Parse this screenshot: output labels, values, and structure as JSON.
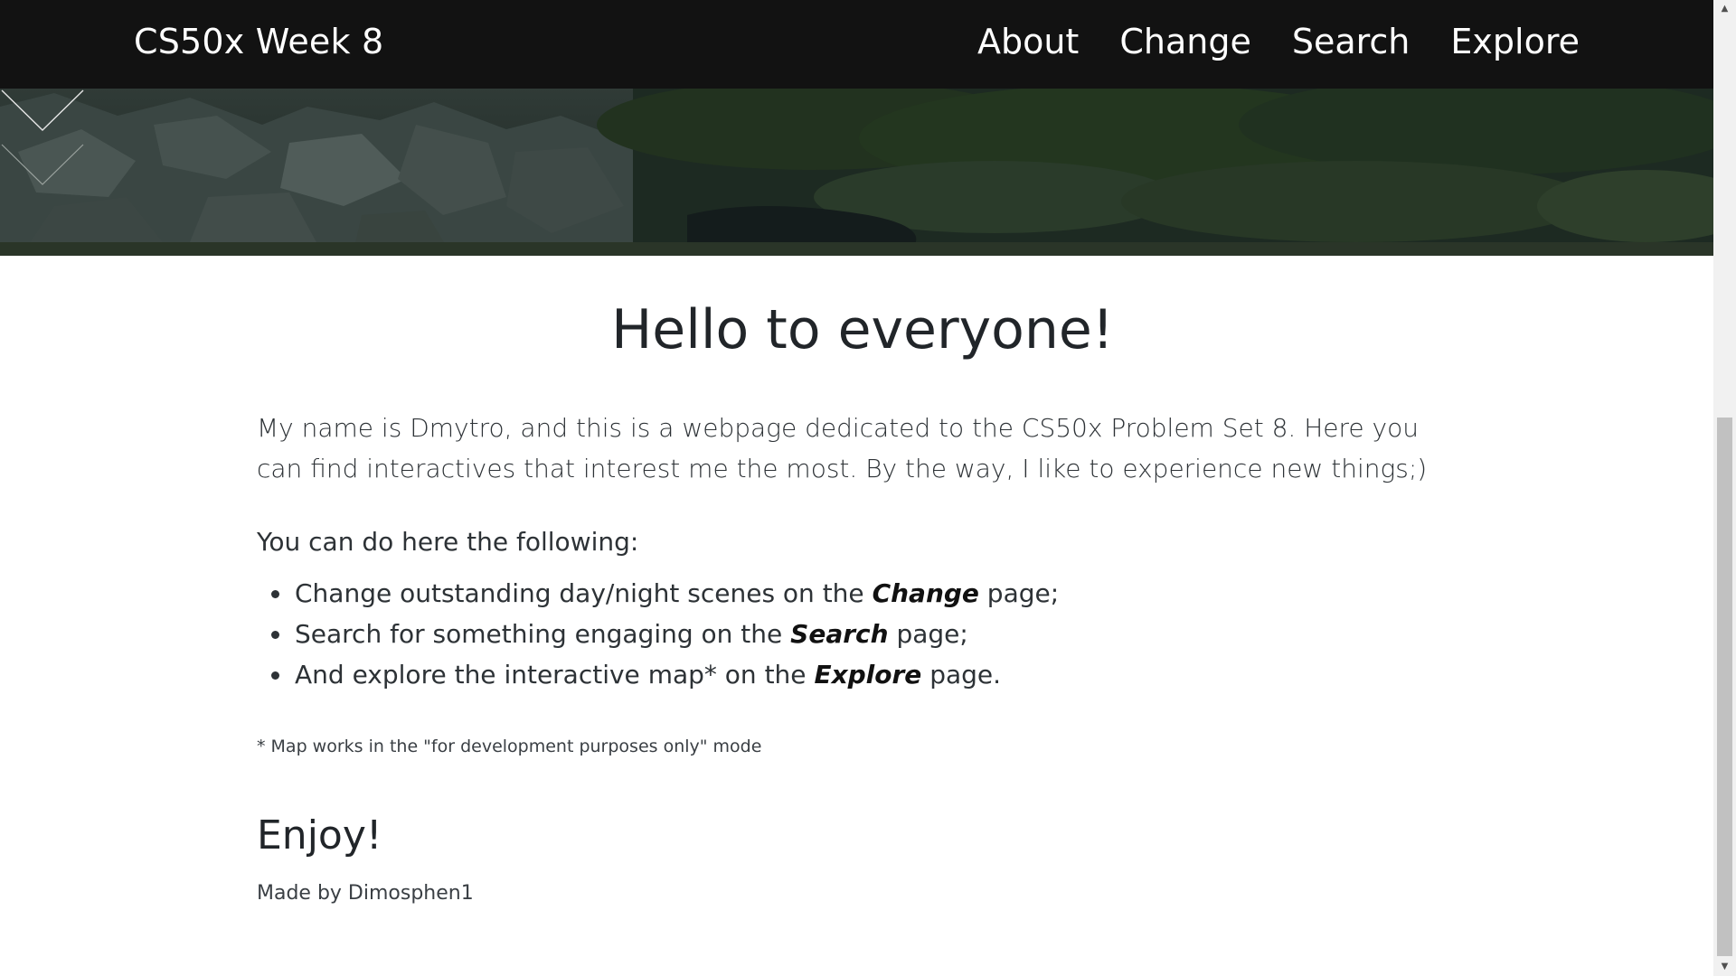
{
  "navbar": {
    "brand": "CS50x Week 8",
    "links": [
      "About",
      "Change",
      "Search",
      "Explore"
    ]
  },
  "main": {
    "title": "Hello to everyone!",
    "intro": "My name is Dmytro, and this is a webpage dedicated to the CS50x Problem Set 8. Here you can find interactives that interest me the most. By the way, I like to experience new things;)",
    "lead_in": "You can do here the following:",
    "features": [
      {
        "before": "Change outstanding day/night scenes on the ",
        "emph": "Change",
        "after": " page;"
      },
      {
        "before": "Search for something engaging on the ",
        "emph": "Search",
        "after": " page;"
      },
      {
        "before": "And explore the interactive map* on the ",
        "emph": "Explore",
        "after": " page."
      }
    ],
    "footnote": "* Map works in the \"for development purposes only\" mode",
    "enjoy": "Enjoy!",
    "credit": "Made by Dimosphen1"
  },
  "icons": {
    "hero_scroll": "double-chevron-down-icon",
    "scroll_up": "triangle-up-icon",
    "scroll_down": "triangle-down-icon"
  },
  "scrollbar": {
    "position": 0.47
  },
  "colors": {
    "navbar_bg": "#121212",
    "nav_text": "#ffffff",
    "text": "#212529"
  }
}
